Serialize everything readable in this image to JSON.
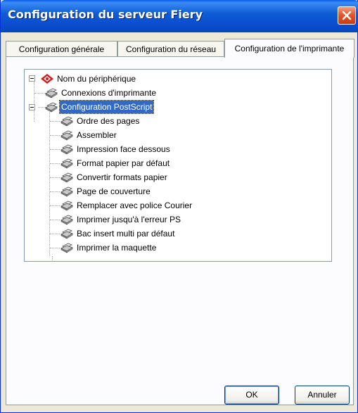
{
  "window": {
    "title": "Configuration du serveur Fiery"
  },
  "tabs": [
    {
      "label": "Configuration générale"
    },
    {
      "label": "Configuration du réseau"
    },
    {
      "label": "Configuration de l'imprimante"
    }
  ],
  "tree": {
    "root": {
      "label": "Nom du périphérique",
      "icon": "fiery-icon"
    },
    "items": [
      {
        "label": "Connexions d'imprimante",
        "icon": "printer-icon"
      },
      {
        "label": "Configuration PostScript",
        "icon": "printer-icon",
        "selected": true,
        "children": [
          "Ordre des pages",
          "Assembler",
          "Impression face dessous",
          "Format papier par défaut",
          "Convertir formats papier",
          "Page de couverture",
          "Remplacer avec police Courier",
          "Imprimer jusqu'à l'erreur PS",
          "Bac insert multi par défaut",
          "Imprimer la maquette"
        ]
      }
    ]
  },
  "buttons": {
    "ok": "OK",
    "cancel": "Annuler"
  },
  "colors": {
    "titlebar": "#0a5ee8",
    "selection": "#316ac5",
    "close": "#e4572d"
  }
}
